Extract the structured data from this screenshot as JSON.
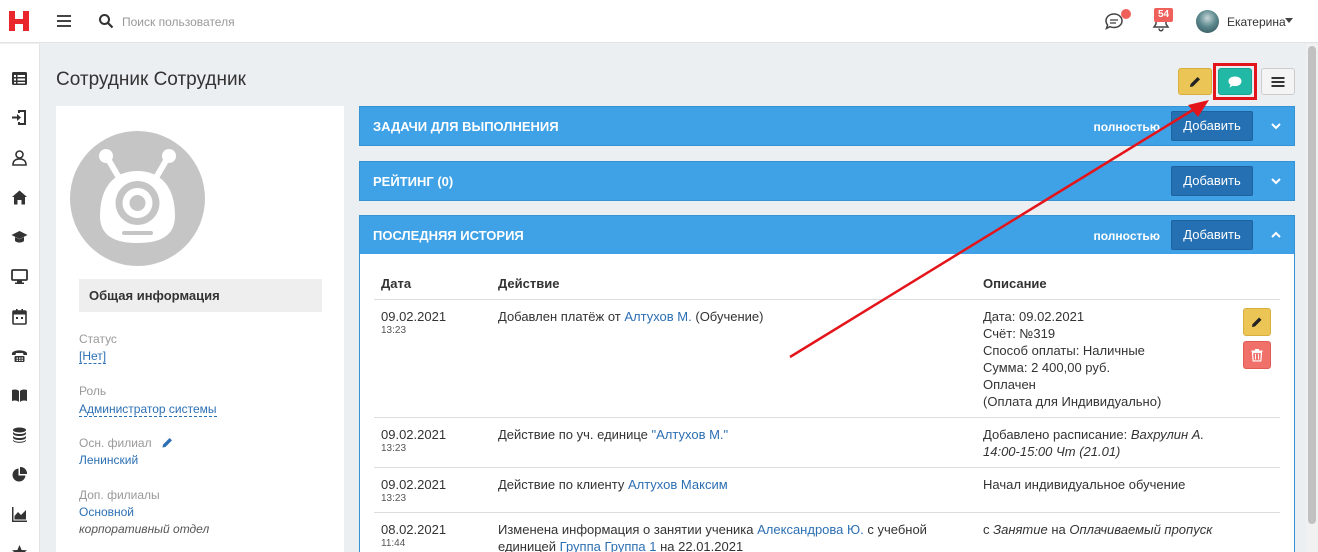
{
  "topbar": {
    "search_placeholder": "Поиск пользователя",
    "notifications_count": "54",
    "user_name": "Екатерина",
    "icons": [
      "logo-icon",
      "menu-icon",
      "search-icon",
      "chat-icon",
      "bell-icon",
      "avatar"
    ]
  },
  "sidebar": {
    "icons": [
      "list-icon",
      "sign-in-icon",
      "user-icon",
      "home-icon",
      "graduation-cap-icon",
      "monitor-icon",
      "calendar-icon",
      "phone-icon",
      "book-icon",
      "coins-icon",
      "pie-chart-icon",
      "area-chart-icon",
      "star-icon"
    ]
  },
  "page": {
    "title": "Сотрудник Сотрудник"
  },
  "profile": {
    "general_info": "Общая информация",
    "status_label": "Статус",
    "status_value": "[Нет]",
    "role_label": "Роль",
    "role_value": "Администратор системы",
    "main_branch_label": "Осн. филиал",
    "main_branch_value": "Ленинский",
    "extra_branches_label": "Доп. филиалы",
    "extra_branch_value": "Основной",
    "extra_branch_note": "корпоративный отдел"
  },
  "panels": {
    "tasks": {
      "title": "ЗАДАЧИ ДЛЯ ВЫПОЛНЕНИЯ",
      "full": "полностью",
      "add": "Добавить"
    },
    "rating": {
      "title": "РЕЙТИНГ (0)",
      "add": "Добавить"
    },
    "history": {
      "title": "ПОСЛЕДНЯЯ ИСТОРИЯ",
      "full": "полностью",
      "add": "Добавить"
    }
  },
  "history_table": {
    "headers": [
      "Дата",
      "Действие",
      "Описание"
    ],
    "rows": [
      {
        "date": "09.02.2021",
        "time": "13:23",
        "action_prefix": "Добавлен платёж от ",
        "action_link": "Алтухов М.",
        "action_suffix": " (Обучение)",
        "desc": [
          "Дата: 09.02.2021",
          "Счёт: №319",
          "Способ оплаты: Наличные",
          "Сумма: 2 400,00 руб.",
          "Оплачен",
          "(Оплата для Индивидуально)"
        ]
      },
      {
        "date": "09.02.2021",
        "time": "13:23",
        "action_prefix": "Действие по уч. единице ",
        "action_link": "\"Алтухов М.\"",
        "action_suffix": "",
        "desc_prefix": "Добавлено расписание: ",
        "desc_em": "Вахрулин А. 14:00-15:00 Чт (21.01)"
      },
      {
        "date": "09.02.2021",
        "time": "13:23",
        "action_prefix": "Действие по клиенту ",
        "action_link": "Алтухов Максим",
        "action_suffix": "",
        "desc_text": "Начал индивидуальное обучение"
      },
      {
        "date": "08.02.2021",
        "time": "11:44",
        "action_prefix": "Изменена информация о занятии ученика ",
        "action_link": "Александрова Ю.",
        "action_mid": " с учебной единицей ",
        "action_link2": "Группа Группа 1",
        "action_suffix": " на 22.01.2021",
        "desc_s": "с ",
        "desc_em1": "Занятие",
        "desc_na": " на ",
        "desc_em2": "Оплачиваемый пропуск"
      }
    ]
  },
  "colors": {
    "panel_blue": "#3fa1e6",
    "button_blue": "#2470b3",
    "edit_yellow": "#ecc557",
    "chat_teal": "#22b8a6",
    "delete_red": "#f0706a",
    "annotation_red": "#e3151a"
  }
}
